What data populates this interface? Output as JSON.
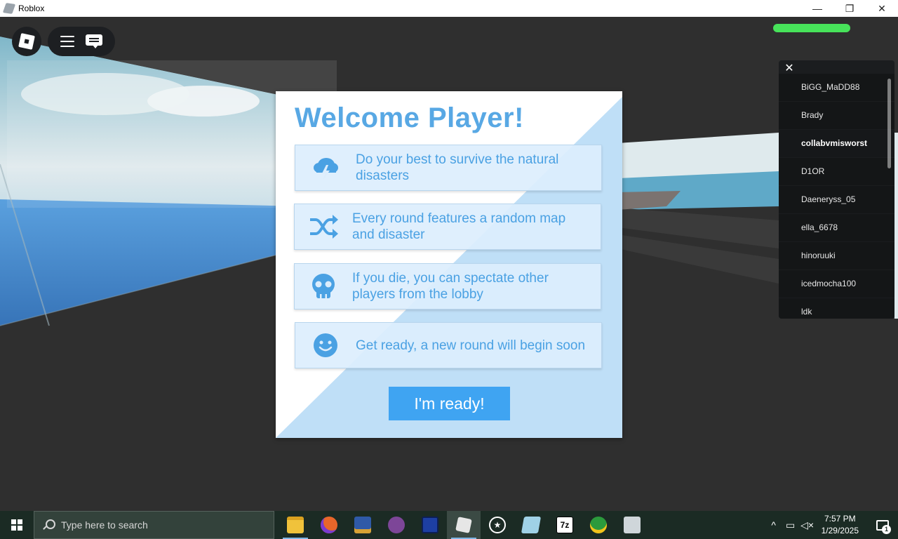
{
  "window": {
    "title": "Roblox",
    "minimize": "—",
    "restore": "❐",
    "close": "✕"
  },
  "game": {
    "player_list": {
      "close": "✕",
      "players": [
        "BiGG_MaDD88",
        "Brady",
        "collabvmisworst",
        "D1OR",
        "Daeneryss_05",
        "ella_6678",
        "hinoruuki",
        "icedmocha100",
        "ldk"
      ],
      "local_player_index": 2
    },
    "dialog": {
      "title": "Welcome Player!",
      "cards": [
        {
          "icon": "storm-cloud-icon",
          "text": "Do your best to survive the natural disasters"
        },
        {
          "icon": "shuffle-icon",
          "text": "Every round features a random map and disaster"
        },
        {
          "icon": "skull-icon",
          "text": "If you die, you can spectate other players from the lobby"
        },
        {
          "icon": "smiley-icon",
          "text": "Get ready, a new round will begin soon"
        }
      ],
      "button": "I'm ready!"
    },
    "health_color": "#47e35a"
  },
  "taskbar": {
    "search_placeholder": "Type here to search",
    "apps": [
      "file-explorer-icon",
      "firefox-icon",
      "winrar-icon",
      "tor-icon",
      "app-icon",
      "roblox-icon",
      "star-icon",
      "roblox-studio-icon",
      "7zip-icon",
      "network-globe-icon",
      "printer-icon"
    ],
    "time": "7:57 PM",
    "date": "1/29/2025",
    "notification_count": "1"
  },
  "colors": {
    "accent": "#3fa4f2",
    "title_blue": "#58a8e4"
  }
}
